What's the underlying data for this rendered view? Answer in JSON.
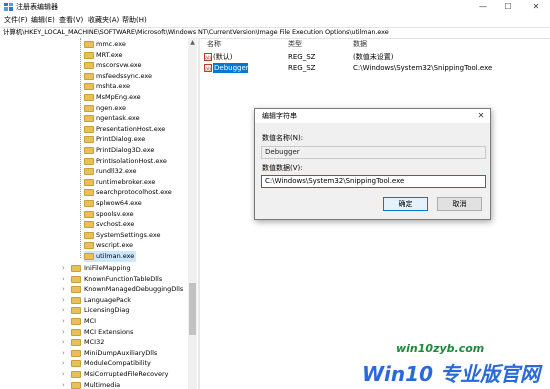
{
  "window": {
    "title": "注册表编辑器",
    "min": "—",
    "max": "☐",
    "close": "✕"
  },
  "menu": [
    "文件(F)",
    "编辑(E)",
    "查看(V)",
    "收藏夹(A)",
    "帮助(H)"
  ],
  "address": "计算机\\HKEY_LOCAL_MACHINE\\SOFTWARE\\Microsoft\\Windows NT\\CurrentVersion\\Image File Execution Options\\utilman.exe",
  "tree": {
    "items_indented": [
      "mmc.exe",
      "MRT.exe",
      "mscorsvw.exe",
      "msfeedssync.exe",
      "mshta.exe",
      "MsMpEng.exe",
      "ngen.exe",
      "ngentask.exe",
      "PresentationHost.exe",
      "PrintDialog.exe",
      "PrintDialog3D.exe",
      "PrintIsolationHost.exe",
      "rundll32.exe",
      "runtimebroker.exe",
      "searchprotocolhost.exe",
      "splwow64.exe",
      "spoolsv.exe",
      "svchost.exe",
      "SystemSettings.exe",
      "wscript.exe",
      "utilman.exe"
    ],
    "items_parent": [
      "IniFileMapping",
      "KnownFunctionTableDlls",
      "KnownManagedDebuggingDlls",
      "LanguagePack",
      "LicensingDiag",
      "MCI",
      "MCI Extensions",
      "MCI32",
      "MiniDumpAuxiliaryDlls",
      "ModuleCompatibility",
      "MsiCorruptedFileRecovery",
      "Multimedia"
    ],
    "chevron": "›"
  },
  "list": {
    "headers": {
      "name": "名称",
      "type": "类型",
      "data": "数据"
    },
    "rows": [
      {
        "icon": "string-value-icon",
        "name": "(默认)",
        "type": "REG_SZ",
        "data": "(数值未设置)"
      },
      {
        "icon": "string-value-icon",
        "name": "Debugger",
        "type": "REG_SZ",
        "data": "C:\\Windows\\System32\\SnippingTool.exe"
      }
    ]
  },
  "dialog": {
    "title": "编辑字符串",
    "close": "✕",
    "name_label": "数值名称(N):",
    "name_value": "Debugger",
    "data_label": "数值数据(V):",
    "data_value": "C:\\Windows\\System32\\SnippingTool.exe",
    "ok": "确定",
    "cancel": "取消"
  },
  "watermark": {
    "url": "win10zyb.com",
    "logo": "Win10 专业版官网"
  }
}
